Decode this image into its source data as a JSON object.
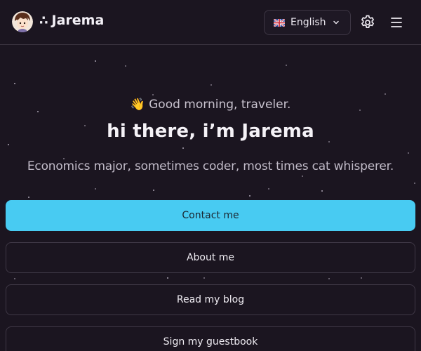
{
  "header": {
    "brand_dots": "∴",
    "brand_name": "Jarema",
    "language": {
      "flag_icon": "uk-flag-icon",
      "selected": "English"
    },
    "icons": [
      "settings-gear-icon",
      "hamburger-menu-icon"
    ]
  },
  "hero": {
    "greeting_emoji": "👋",
    "greeting": "Good morning, traveler.",
    "headline": "hi there, i’m Jarema",
    "tagline": "Economics major, sometimes coder, most times cat whisperer."
  },
  "actions": [
    {
      "label": "Contact me",
      "style": "primary"
    },
    {
      "label": "About me",
      "style": "outline"
    },
    {
      "label": "Read my blog",
      "style": "outline"
    },
    {
      "label": "Sign my guestbook",
      "style": "outline"
    }
  ],
  "colors": {
    "background": "#1b1520",
    "accent": "#48cbf2",
    "border": "#3f3846"
  }
}
